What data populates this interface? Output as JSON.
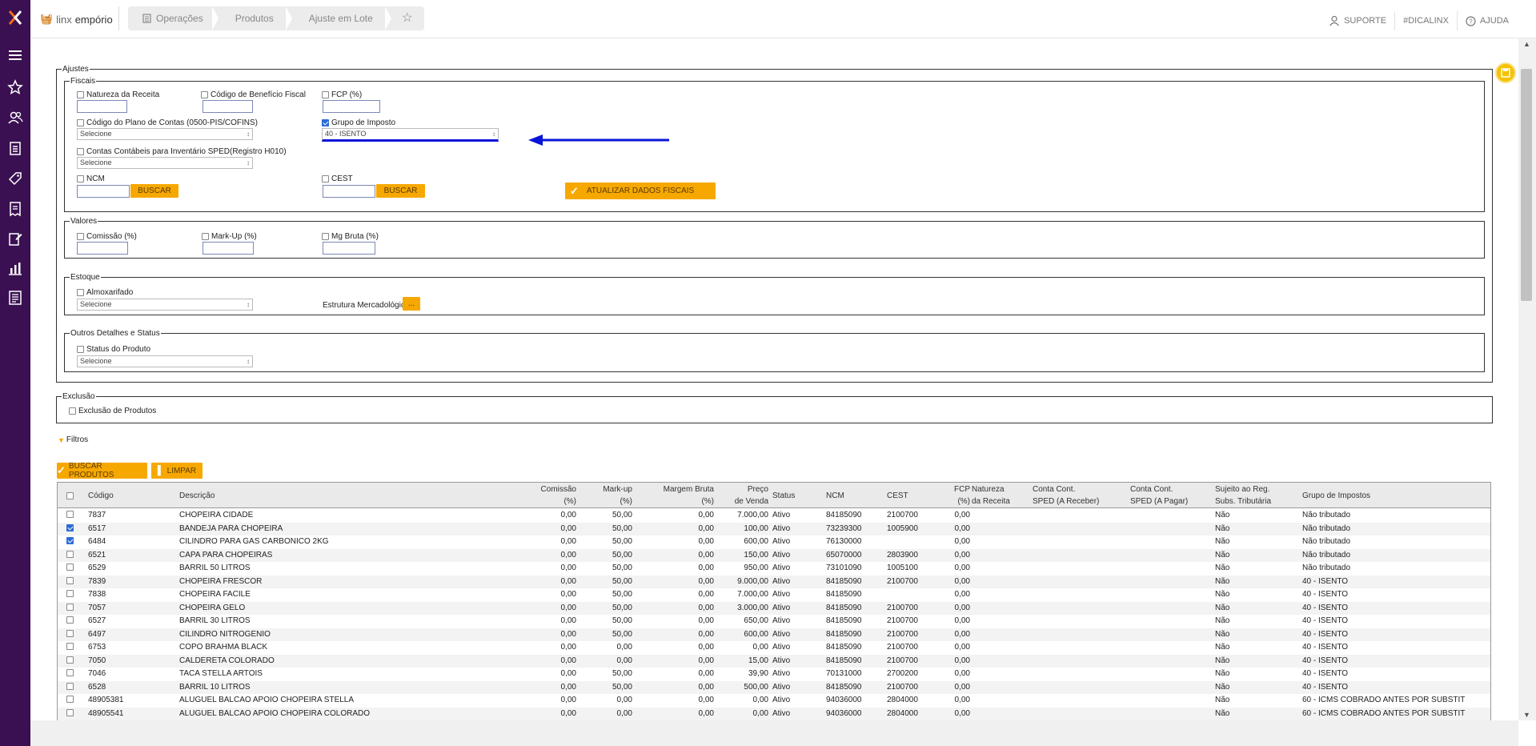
{
  "app": {
    "brand_light": "linx",
    "brand_bold": "empório",
    "breadcrumbs": [
      "Operações",
      "Produtos",
      "Ajuste em Lote"
    ],
    "top_links": [
      "SUPORTE",
      "#DICALINX",
      "AJUDA"
    ],
    "colors": {
      "sidebar": "#3b1052",
      "accent": "#f6a800",
      "arrow": "#0a14d8"
    }
  },
  "sidebar": {
    "icons": [
      "menu-icon",
      "star-icon",
      "users-icon",
      "clipboard-icon",
      "tag-icon",
      "receipt-icon",
      "edit-doc-icon",
      "bar-chart-icon",
      "report-icon"
    ]
  },
  "ajustes": {
    "legend": "Ajustes",
    "fiscais": {
      "legend": "Fiscais",
      "natureza_receita": "Natureza da Receita",
      "codigo_beneficio": "Código de Benefício Fiscal",
      "fcp": "FCP (%)",
      "codigo_plano": "Código do Plano de Contas (0500-PIS/COFINS)",
      "codigo_plano_select": "Selecione",
      "grupo_imposto": "Grupo de Imposto",
      "grupo_imposto_select": "40 - ISENTO",
      "contas_contabeis": "Contas Contábeis para Inventário SPED(Registro H010)",
      "contas_contabeis_select": "Selecione",
      "ncm": "NCM",
      "cest": "CEST",
      "buscar": "BUSCAR",
      "atualizar": "ATUALIZAR DADOS FISCAIS"
    },
    "valores": {
      "legend": "Valores",
      "comissao": "Comissão (%)",
      "markup": "Mark-Up (%)",
      "mg_bruta": "Mg Bruta (%)"
    },
    "estoque": {
      "legend": "Estoque",
      "almoxarifado": "Almoxarifado",
      "almoxarifado_select": "Selecione",
      "estrutura": "Estrutura Mercadológica*",
      "estrutura_btn": "..."
    },
    "outros": {
      "legend": "Outros Detalhes e Status",
      "status": "Status do Produto",
      "status_select": "Selecione"
    }
  },
  "exclusao": {
    "legend": "Exclusão",
    "label": "Exclusão de Produtos"
  },
  "filtros": "Filtros",
  "actions": {
    "buscar_produtos": "BUSCAR PRODUTOS",
    "limpar": "LIMPAR"
  },
  "table": {
    "headers": {
      "codigo": "Código",
      "descricao": "Descrição",
      "comissao_1": "Comissão",
      "comissao_2": "(%)",
      "markup_1": "Mark-up",
      "markup_2": "(%)",
      "margem_1": "Margem Bruta",
      "margem_2": "(%)",
      "preco_1": "Preço",
      "preco_2": "de Venda",
      "status": "Status",
      "ncm": "NCM",
      "cest": "CEST",
      "fcp_1": "FCP",
      "fcp_2": "(%)",
      "natureza_1": "Natureza",
      "natureza_2": "da Receita",
      "conta_receber_1": "Conta Cont.",
      "conta_receber_2": "SPED (A Receber)",
      "conta_pagar_1": "Conta Cont.",
      "conta_pagar_2": "SPED (A Pagar)",
      "sujeito_1": "Sujeito ao Reg.",
      "sujeito_2": "Subs. Tributária",
      "grupo": "Grupo de Impostos"
    },
    "rows": [
      {
        "checked": false,
        "codigo": "7837",
        "descricao": "CHOPEIRA CIDADE",
        "comissao": "0,00",
        "markup": "50,00",
        "margem": "0,00",
        "preco": "7.000,00",
        "status": "Ativo",
        "ncm": "84185090",
        "cest": "2100700",
        "fcp": "0,00",
        "sujeito": "Não",
        "grupo": "Não tributado"
      },
      {
        "checked": true,
        "codigo": "6517",
        "descricao": "BANDEJA PARA CHOPEIRA",
        "comissao": "0,00",
        "markup": "50,00",
        "margem": "0,00",
        "preco": "100,00",
        "status": "Ativo",
        "ncm": "73239300",
        "cest": "1005900",
        "fcp": "0,00",
        "sujeito": "Não",
        "grupo": "Não tributado"
      },
      {
        "checked": true,
        "codigo": "6484",
        "descricao": "CILINDRO PARA GAS CARBONICO 2KG",
        "comissao": "0,00",
        "markup": "50,00",
        "margem": "0,00",
        "preco": "600,00",
        "status": "Ativo",
        "ncm": "76130000",
        "cest": "",
        "fcp": "0,00",
        "sujeito": "Não",
        "grupo": "Não tributado"
      },
      {
        "checked": false,
        "codigo": "6521",
        "descricao": "CAPA PARA CHOPEIRAS",
        "comissao": "0,00",
        "markup": "50,00",
        "margem": "0,00",
        "preco": "150,00",
        "status": "Ativo",
        "ncm": "65070000",
        "cest": "2803900",
        "fcp": "0,00",
        "sujeito": "Não",
        "grupo": "Não tributado"
      },
      {
        "checked": false,
        "codigo": "6529",
        "descricao": "BARRIL 50 LITROS",
        "comissao": "0,00",
        "markup": "50,00",
        "margem": "0,00",
        "preco": "950,00",
        "status": "Ativo",
        "ncm": "73101090",
        "cest": "1005100",
        "fcp": "0,00",
        "sujeito": "Não",
        "grupo": "Não tributado"
      },
      {
        "checked": false,
        "codigo": "7839",
        "descricao": "CHOPEIRA FRESCOR",
        "comissao": "0,00",
        "markup": "50,00",
        "margem": "0,00",
        "preco": "9.000,00",
        "status": "Ativo",
        "ncm": "84185090",
        "cest": "2100700",
        "fcp": "0,00",
        "sujeito": "Não",
        "grupo": "40 - ISENTO"
      },
      {
        "checked": false,
        "codigo": "7838",
        "descricao": "CHOPEIRA FACILE",
        "comissao": "0,00",
        "markup": "50,00",
        "margem": "0,00",
        "preco": "7.000,00",
        "status": "Ativo",
        "ncm": "84185090",
        "cest": "",
        "fcp": "0,00",
        "sujeito": "Não",
        "grupo": "40 - ISENTO"
      },
      {
        "checked": false,
        "codigo": "7057",
        "descricao": "CHOPEIRA GELO",
        "comissao": "0,00",
        "markup": "50,00",
        "margem": "0,00",
        "preco": "3.000,00",
        "status": "Ativo",
        "ncm": "84185090",
        "cest": "2100700",
        "fcp": "0,00",
        "sujeito": "Não",
        "grupo": "40 - ISENTO"
      },
      {
        "checked": false,
        "codigo": "6527",
        "descricao": "BARRIL 30 LITROS",
        "comissao": "0,00",
        "markup": "50,00",
        "margem": "0,00",
        "preco": "650,00",
        "status": "Ativo",
        "ncm": "84185090",
        "cest": "2100700",
        "fcp": "0,00",
        "sujeito": "Não",
        "grupo": "40 - ISENTO"
      },
      {
        "checked": false,
        "codigo": "6497",
        "descricao": "CILINDRO NITROGENIO",
        "comissao": "0,00",
        "markup": "50,00",
        "margem": "0,00",
        "preco": "600,00",
        "status": "Ativo",
        "ncm": "84185090",
        "cest": "2100700",
        "fcp": "0,00",
        "sujeito": "Não",
        "grupo": "40 - ISENTO"
      },
      {
        "checked": false,
        "codigo": "6753",
        "descricao": "COPO BRAHMA BLACK",
        "comissao": "0,00",
        "markup": "0,00",
        "margem": "0,00",
        "preco": "0,00",
        "status": "Ativo",
        "ncm": "84185090",
        "cest": "2100700",
        "fcp": "0,00",
        "sujeito": "Não",
        "grupo": "40 - ISENTO"
      },
      {
        "checked": false,
        "codigo": "7050",
        "descricao": "CALDERETA COLORADO",
        "comissao": "0,00",
        "markup": "0,00",
        "margem": "0,00",
        "preco": "15,00",
        "status": "Ativo",
        "ncm": "84185090",
        "cest": "2100700",
        "fcp": "0,00",
        "sujeito": "Não",
        "grupo": "40 - ISENTO"
      },
      {
        "checked": false,
        "codigo": "7046",
        "descricao": "TACA STELLA ARTOIS",
        "comissao": "0,00",
        "markup": "50,00",
        "margem": "0,00",
        "preco": "39,90",
        "status": "Ativo",
        "ncm": "70131000",
        "cest": "2700200",
        "fcp": "0,00",
        "sujeito": "Não",
        "grupo": "40 - ISENTO"
      },
      {
        "checked": false,
        "codigo": "6528",
        "descricao": "BARRIL 10 LITROS",
        "comissao": "0,00",
        "markup": "50,00",
        "margem": "0,00",
        "preco": "500,00",
        "status": "Ativo",
        "ncm": "84185090",
        "cest": "2100700",
        "fcp": "0,00",
        "sujeito": "Não",
        "grupo": "40 - ISENTO"
      },
      {
        "checked": false,
        "codigo": "48905381",
        "descricao": "ALUGUEL BALCAO APOIO CHOPEIRA STELLA",
        "comissao": "0,00",
        "markup": "0,00",
        "margem": "0,00",
        "preco": "0,00",
        "status": "Ativo",
        "ncm": "94036000",
        "cest": "2804000",
        "fcp": "0,00",
        "sujeito": "Não",
        "grupo": "60 - ICMS COBRADO ANTES POR SUBSTIT"
      },
      {
        "checked": false,
        "codigo": "48905541",
        "descricao": "ALUGUEL BALCAO APOIO CHOPEIRA COLORADO",
        "comissao": "0,00",
        "markup": "0,00",
        "margem": "0,00",
        "preco": "0,00",
        "status": "Ativo",
        "ncm": "94036000",
        "cest": "2804000",
        "fcp": "0,00",
        "sujeito": "Não",
        "grupo": "60 - ICMS COBRADO ANTES POR SUBSTIT"
      }
    ]
  }
}
